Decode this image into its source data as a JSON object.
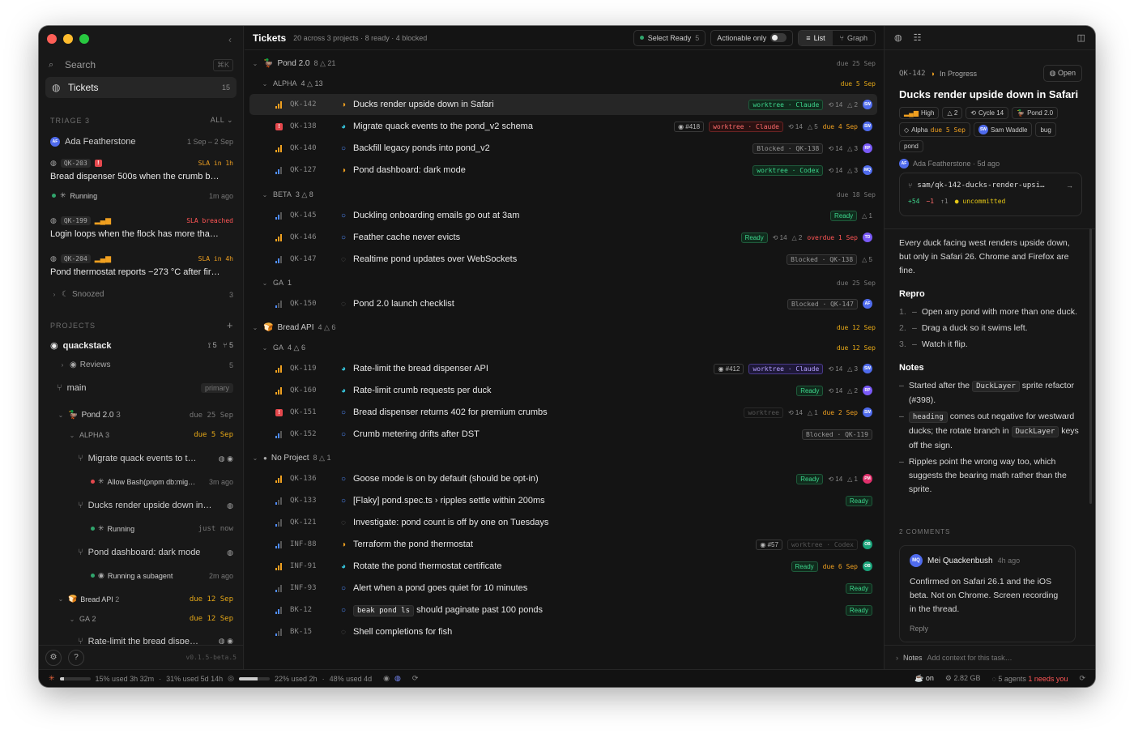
{
  "sidebar": {
    "search": {
      "label": "Search",
      "shortcut": "⌘K"
    },
    "tickets": {
      "label": "Tickets",
      "count": "15"
    },
    "triage": {
      "title": "TRIAGE",
      "count": "3",
      "filter": "ALL ⌄"
    },
    "triage_owner": {
      "avatar": "AF",
      "name": "Ada Featherstone",
      "range": "1 Sep – 2 Sep"
    },
    "triage_items": [
      {
        "id": "QK-203",
        "sla": "SLA in 1h",
        "title": "Bread dispenser 500s when the crumb b…",
        "sub": "Running",
        "sub_time": "1m ago"
      },
      {
        "id": "QK-199",
        "sla": "SLA breached",
        "title": "Login loops when the flock has more tha…"
      },
      {
        "id": "QK-204",
        "sla": "SLA in 4h",
        "title": "Pond thermostat reports −273 °C after fir…"
      }
    ],
    "snoozed": {
      "label": "Snoozed",
      "count": "3"
    },
    "projects": {
      "title": "PROJECTS",
      "add": "+"
    },
    "repo": {
      "name": "quackstack",
      "prs": "5",
      "branches": "5"
    },
    "reviews": {
      "label": "Reviews",
      "count": "5"
    },
    "main_branch": {
      "label": "main",
      "badge": "primary"
    },
    "pond": {
      "label": "Pond 2.0",
      "count": "3",
      "due": "due 25 Sep"
    },
    "alpha": {
      "label": "ALPHA",
      "count": "3",
      "due": "due 5 Sep"
    },
    "worktrees": [
      {
        "title": "Migrate quack events to t…",
        "sub": "Allow Bash(pnpm db:mig…",
        "time": "3m ago"
      },
      {
        "title": "Ducks render upside down in…",
        "sub": "Running",
        "time": "just now"
      },
      {
        "title": "Pond dashboard: dark mode",
        "sub": "Running a subagent",
        "time": "2m ago"
      }
    ],
    "bread": {
      "label": "Bread API",
      "count": "2",
      "due": "due 12 Sep"
    },
    "ga": {
      "label": "GA",
      "count": "2",
      "due": "due 12 Sep"
    },
    "last_item": "Rate-limit the bread dispe…",
    "version": "v0.1.5-beta.5"
  },
  "toolbar": {
    "title": "Tickets",
    "subtitle": "20 across 3 projects · 8 ready · 4 blocked",
    "select_ready": "Select Ready",
    "select_ready_count": "5",
    "actionable": "Actionable only",
    "list": "List",
    "graph": "Graph"
  },
  "groups": [
    {
      "label": "Pond 2.0",
      "meta": "8 △ 21",
      "due": "due 25 Sep"
    },
    {
      "label": "ALPHA",
      "meta": "4 △ 13",
      "due": "due 5 Sep"
    },
    {
      "label": "BETA",
      "meta": "3 △ 8",
      "due": "due 18 Sep"
    },
    {
      "label": "GA",
      "meta": "1",
      "due": "due 25 Sep"
    },
    {
      "label": "Bread API",
      "meta": "4 △ 6",
      "due": "due 12 Sep"
    },
    {
      "label": "GA",
      "meta": "4 △ 6",
      "due": "due 12 Sep"
    },
    {
      "label": "No Project",
      "meta": "8 △ 1",
      "due": ""
    }
  ],
  "tickets": [
    {
      "id": "QK-142",
      "title": "Ducks render upside down in Safari",
      "chip": "worktree · Claude",
      "stat1": "14",
      "stat2": "△ 2",
      "avatar": "SW"
    },
    {
      "id": "QK-138",
      "title": "Migrate quack events to the pond_v2 schema",
      "pr": "#418",
      "chip": "worktree · Claude",
      "stat1": "14",
      "stat2": "△ 5",
      "due": "due 4 Sep",
      "avatar": "SW"
    },
    {
      "id": "QK-140",
      "title": "Backfill legacy ponds into pond_v2",
      "chip": "Blocked · QK-138",
      "stat1": "14",
      "stat2": "△ 3",
      "avatar": "RP"
    },
    {
      "id": "QK-127",
      "title": "Pond dashboard: dark mode",
      "chip": "worktree · Codex",
      "stat1": "14",
      "stat2": "△ 3",
      "avatar": "MQ"
    },
    {
      "id": "QK-145",
      "title": "Duckling onboarding emails go out at 3am",
      "chip": "Ready",
      "stat2": "△ 1"
    },
    {
      "id": "QK-146",
      "title": "Feather cache never evicts",
      "chip": "Ready",
      "stat1": "14",
      "stat2": "△ 2",
      "due": "overdue 1 Sep",
      "avatar": "TD"
    },
    {
      "id": "QK-147",
      "title": "Realtime pond updates over WebSockets",
      "chip": "Blocked · QK-138",
      "stat2": "△ 5"
    },
    {
      "id": "QK-150",
      "title": "Pond 2.0 launch checklist",
      "chip": "Blocked · QK-147",
      "avatar": "AF"
    },
    {
      "id": "QK-119",
      "title": "Rate-limit the bread dispenser API",
      "pr": "#412",
      "chip": "worktree · Claude",
      "stat1": "14",
      "stat2": "△ 3",
      "avatar": "SW"
    },
    {
      "id": "QK-160",
      "title": "Rate-limit crumb requests per duck",
      "chip": "Ready",
      "stat1": "14",
      "stat2": "△ 2",
      "avatar": "RP"
    },
    {
      "id": "QK-151",
      "title": "Bread dispenser returns 402 for premium crumbs",
      "chip": "worktree",
      "stat1": "14",
      "stat2": "△ 1",
      "due": "due 2 Sep",
      "avatar": "SW"
    },
    {
      "id": "QK-152",
      "title": "Crumb metering drifts after DST",
      "chip": "Blocked · QK-119"
    },
    {
      "id": "QK-136",
      "title": "Goose mode is on by default (should be opt-in)",
      "chip": "Ready",
      "stat1": "14",
      "stat2": "△ 1",
      "avatar": "PM"
    },
    {
      "id": "QK-133",
      "title": "[Flaky] pond.spec.ts › ripples settle within 200ms",
      "chip": "Ready"
    },
    {
      "id": "QK-121",
      "title": "Investigate: pond count is off by one on Tuesdays"
    },
    {
      "id": "INF-88",
      "title": "Terraform the pond thermostat",
      "pr": "#57",
      "chip": "worktree · Codex",
      "avatar": "OB"
    },
    {
      "id": "INF-91",
      "title": "Rotate the pond thermostat certificate",
      "chip": "Ready",
      "due": "due 6 Sep",
      "avatar": "OB"
    },
    {
      "id": "INF-93",
      "title": "Alert when a pond goes quiet for 10 minutes",
      "chip": "Ready"
    },
    {
      "id": "BK-12",
      "code": "beak pond ls",
      "title": "should paginate past 100 ponds",
      "chip": "Ready"
    },
    {
      "id": "BK-15",
      "title": "Shell completions for fish"
    }
  ],
  "detail": {
    "id": "QK-142",
    "status": "In Progress",
    "open": "Open",
    "title": "Ducks render upside down in Safari",
    "chips": [
      "High",
      "△ 2",
      "Cycle 14",
      "Pond 2.0",
      "Alpha",
      "due 5 Sep",
      "Sam Waddle",
      "bug",
      "pond"
    ],
    "author_avatar": "AF",
    "author": "Ada Featherstone · 5d ago",
    "branch": "sam/qk-142-ducks-render-upsi…",
    "adds": "+54",
    "dels": "−1",
    "sync": "↑1",
    "uncommitted": "uncommitted",
    "desc": "Every duck facing west renders upside down, but only in Safari 26. Chrome and Firefox are fine.",
    "repro_title": "Repro",
    "repro": [
      "Open any pond with more than one duck.",
      "Drag a duck so it swims left.",
      "Watch it flip."
    ],
    "notes_title": "Notes",
    "note1_a": "Started after the",
    "note1_code": "DuckLayer",
    "note1_b": "sprite refactor (#398).",
    "note2_code": "heading",
    "note2_a": "comes out negative for westward ducks; the rotate branch in",
    "note2_code2": "DuckLayer",
    "note2_b": "keys off the sign.",
    "note3": "Ripples point the wrong way too, which suggests the bearing math rather than the sprite.",
    "comments_title": "2 COMMENTS",
    "comment": {
      "avatar": "MQ",
      "author": "Mei Quackenbush",
      "ago": "4h ago",
      "body": "Confirmed on Safari 26.1 and the iOS beta. Not on Chrome. Screen recording in the thread.",
      "reply": "Reply"
    },
    "notes_label": "Notes",
    "notes_placeholder": "Add context for this task…"
  },
  "status": {
    "u1": "15% used 3h 32m",
    "u2": "31% used 5d 14h",
    "u3": "22% used 2h",
    "u4": "48% used 4d",
    "on": "on",
    "mem": "2.82 GB",
    "agents": "5 agents",
    "needs": "1 needs you"
  }
}
